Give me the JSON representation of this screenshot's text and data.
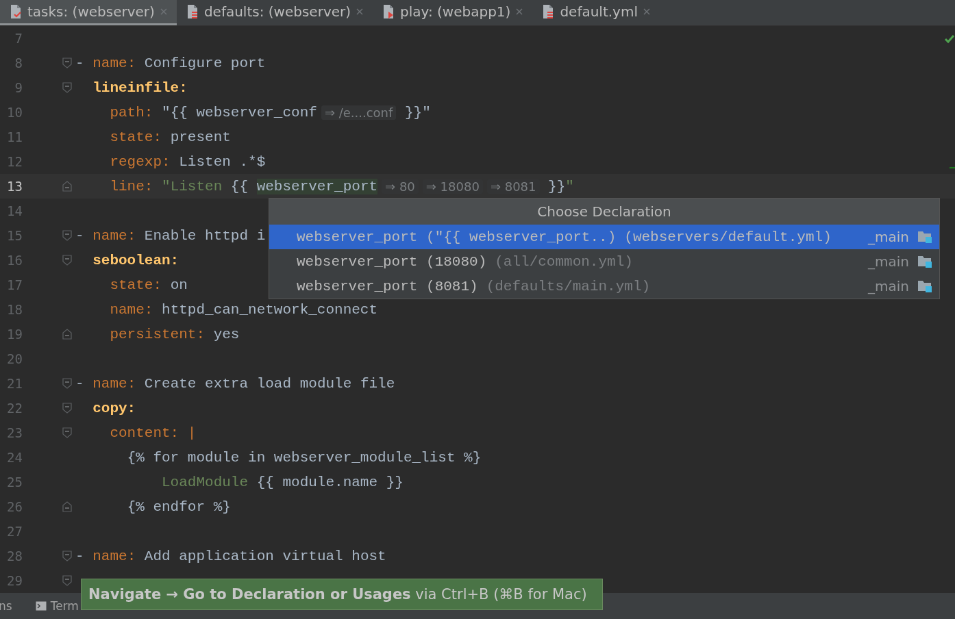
{
  "tabs": [
    {
      "label": "tasks: (webserver)",
      "kind": "tasks",
      "selected": true
    },
    {
      "label": "defaults: (webserver)",
      "kind": "vars",
      "selected": false
    },
    {
      "label": "play: (webapp1)",
      "kind": "play",
      "selected": false
    },
    {
      "label": "default.yml",
      "kind": "vars",
      "selected": false
    }
  ],
  "editor": {
    "lines": [
      {
        "number": "7",
        "kind": "plain",
        "current": false
      },
      {
        "number": "8",
        "kind": "fold-start",
        "current": false,
        "tokens": [
          {
            "kind": "plain",
            "text": "- "
          },
          {
            "kind": "key",
            "text": "name:"
          },
          {
            "kind": "plain",
            "text": " Configure port"
          }
        ]
      },
      {
        "number": "9",
        "kind": "fold-start",
        "current": false,
        "tokens": [
          {
            "kind": "key-bold",
            "text": "  lineinfile:"
          }
        ]
      },
      {
        "number": "10",
        "kind": "plain",
        "current": false,
        "tokens": [
          {
            "kind": "key",
            "text": "    path:"
          },
          {
            "kind": "plain",
            "text": " \"{{ webserver_conf"
          },
          {
            "kind": "hint",
            "text": "⇒ /e....conf"
          },
          {
            "kind": "plain",
            "text": " }}\""
          }
        ]
      },
      {
        "number": "11",
        "kind": "plain",
        "current": false,
        "tokens": [
          {
            "kind": "key",
            "text": "    state:"
          },
          {
            "kind": "plain",
            "text": " present"
          }
        ]
      },
      {
        "number": "12",
        "kind": "plain",
        "current": false,
        "tokens": [
          {
            "kind": "key",
            "text": "    regexp:"
          },
          {
            "kind": "plain",
            "text": " Listen .*$"
          }
        ]
      },
      {
        "number": "13",
        "kind": "fold-end",
        "current": true,
        "tokens": [
          {
            "kind": "key",
            "text": "    line:"
          },
          {
            "kind": "string",
            "text": " \"Listen "
          },
          {
            "kind": "plain",
            "text": "{{ "
          },
          {
            "kind": "match",
            "text": "webserver_port"
          },
          {
            "kind": "hint",
            "text": "⇒ 80"
          },
          {
            "kind": "hint",
            "text": "⇒ 18080"
          },
          {
            "kind": "hint",
            "text": "⇒ 8081"
          },
          {
            "kind": "plain",
            "text": " }}"
          },
          {
            "kind": "string",
            "text": "\""
          }
        ]
      },
      {
        "number": "14",
        "kind": "plain",
        "current": false
      },
      {
        "number": "15",
        "kind": "fold-start",
        "current": false,
        "tokens": [
          {
            "kind": "plain",
            "text": "- "
          },
          {
            "kind": "key",
            "text": "name:"
          },
          {
            "kind": "plain",
            "text": " Enable httpd i"
          }
        ]
      },
      {
        "number": "16",
        "kind": "fold-start",
        "current": false,
        "tokens": [
          {
            "kind": "key-bold",
            "text": "  seboolean:"
          }
        ]
      },
      {
        "number": "17",
        "kind": "plain",
        "current": false,
        "tokens": [
          {
            "kind": "key",
            "text": "    state:"
          },
          {
            "kind": "plain",
            "text": " on"
          }
        ]
      },
      {
        "number": "18",
        "kind": "plain",
        "current": false,
        "tokens": [
          {
            "kind": "key",
            "text": "    name:"
          },
          {
            "kind": "plain",
            "text": " httpd_can_network_connect"
          }
        ]
      },
      {
        "number": "19",
        "kind": "fold-end",
        "current": false,
        "tokens": [
          {
            "kind": "key",
            "text": "    persistent:"
          },
          {
            "kind": "plain",
            "text": " yes"
          }
        ]
      },
      {
        "number": "20",
        "kind": "plain",
        "current": false
      },
      {
        "number": "21",
        "kind": "fold-start",
        "current": false,
        "tokens": [
          {
            "kind": "plain",
            "text": "- "
          },
          {
            "kind": "key",
            "text": "name:"
          },
          {
            "kind": "plain",
            "text": " Create extra load module file"
          }
        ]
      },
      {
        "number": "22",
        "kind": "fold-start",
        "current": false,
        "tokens": [
          {
            "kind": "key-bold",
            "text": "  copy:"
          }
        ]
      },
      {
        "number": "23",
        "kind": "fold-start",
        "current": false,
        "tokens": [
          {
            "kind": "key",
            "text": "    content:"
          },
          {
            "kind": "key",
            "text": " |"
          }
        ]
      },
      {
        "number": "24",
        "kind": "plain",
        "current": false,
        "tokens": [
          {
            "kind": "plain",
            "text": "      {% for module in webserver_module_list %}"
          }
        ]
      },
      {
        "number": "25",
        "kind": "plain",
        "current": false,
        "tokens": [
          {
            "kind": "string",
            "text": "          LoadModule"
          },
          {
            "kind": "plain",
            "text": " {{ module.name }}"
          }
        ]
      },
      {
        "number": "26",
        "kind": "fold-end",
        "current": false,
        "tokens": [
          {
            "kind": "plain",
            "text": "      {% endfor %}"
          }
        ]
      },
      {
        "number": "27",
        "kind": "plain",
        "current": false
      },
      {
        "number": "28",
        "kind": "fold-start",
        "current": false,
        "tokens": [
          {
            "kind": "plain",
            "text": "- "
          },
          {
            "kind": "key",
            "text": "name:"
          },
          {
            "kind": "plain",
            "text": " Add application virtual host"
          }
        ]
      },
      {
        "number": "29",
        "kind": "fold-start",
        "current": false
      }
    ]
  },
  "popup": {
    "title": "Choose Declaration",
    "items": [
      {
        "name": "webserver_port",
        "detail": "(\"{{ webserver_port..)",
        "location": "(webservers/default.yml)",
        "module": "_main",
        "selected": true
      },
      {
        "name": "webserver_port",
        "detail": "(18080)",
        "location": "(all/common.yml)",
        "module": "_main",
        "selected": false
      },
      {
        "name": "webserver_port",
        "detail": "(8081)",
        "location": "(defaults/main.yml)",
        "module": "_main",
        "selected": false
      }
    ]
  },
  "status_bar": [
    {
      "label": "ns",
      "kind": "text"
    },
    {
      "label": "Term",
      "kind": "terminal"
    }
  ],
  "tip": "**Navigate → Go to Declaration or Usages** via Ctrl+B (⌘B for Mac)"
}
